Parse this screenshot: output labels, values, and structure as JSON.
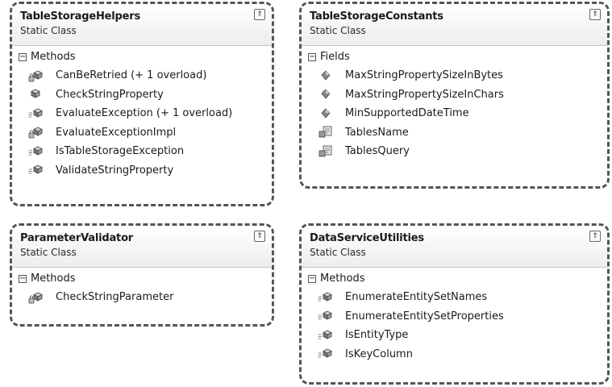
{
  "cards": [
    {
      "title": "TableStorageHelpers",
      "stereotype": "Static Class",
      "section": "Methods",
      "members": [
        {
          "name": "CanBeRetried (+ 1 overload)",
          "icon": "private-method-icon"
        },
        {
          "name": "CheckStringProperty",
          "icon": "method-icon"
        },
        {
          "name": "EvaluateException (+ 1 overload)",
          "icon": "internal-method-icon"
        },
        {
          "name": "EvaluateExceptionImpl",
          "icon": "private-method-icon"
        },
        {
          "name": "IsTableStorageException",
          "icon": "internal-method-icon"
        },
        {
          "name": "ValidateStringProperty",
          "icon": "internal-method-icon"
        }
      ]
    },
    {
      "title": "TableStorageConstants",
      "stereotype": "Static Class",
      "section": "Fields",
      "members": [
        {
          "name": "MaxStringPropertySizeInBytes",
          "icon": "field-icon"
        },
        {
          "name": "MaxStringPropertySizeInChars",
          "icon": "field-icon"
        },
        {
          "name": "MinSupportedDateTime",
          "icon": "field-icon"
        },
        {
          "name": "TablesName",
          "icon": "constant-field-icon"
        },
        {
          "name": "TablesQuery",
          "icon": "constant-field-icon"
        }
      ]
    },
    {
      "title": "ParameterValidator",
      "stereotype": "Static Class",
      "section": "Methods",
      "members": [
        {
          "name": "CheckStringParameter",
          "icon": "private-method-icon"
        }
      ]
    },
    {
      "title": "DataServiceUtilities",
      "stereotype": "Static Class",
      "section": "Methods",
      "members": [
        {
          "name": "EnumerateEntitySetNames",
          "icon": "internal-method-icon"
        },
        {
          "name": "EnumerateEntitySetProperties",
          "icon": "internal-method-icon"
        },
        {
          "name": "IsEntityType",
          "icon": "internal-method-icon"
        },
        {
          "name": "IsKeyColumn",
          "icon": "internal-method-icon"
        }
      ]
    }
  ],
  "ui": {
    "collapse_glyph": "⇑",
    "toggle_glyph": "−"
  }
}
